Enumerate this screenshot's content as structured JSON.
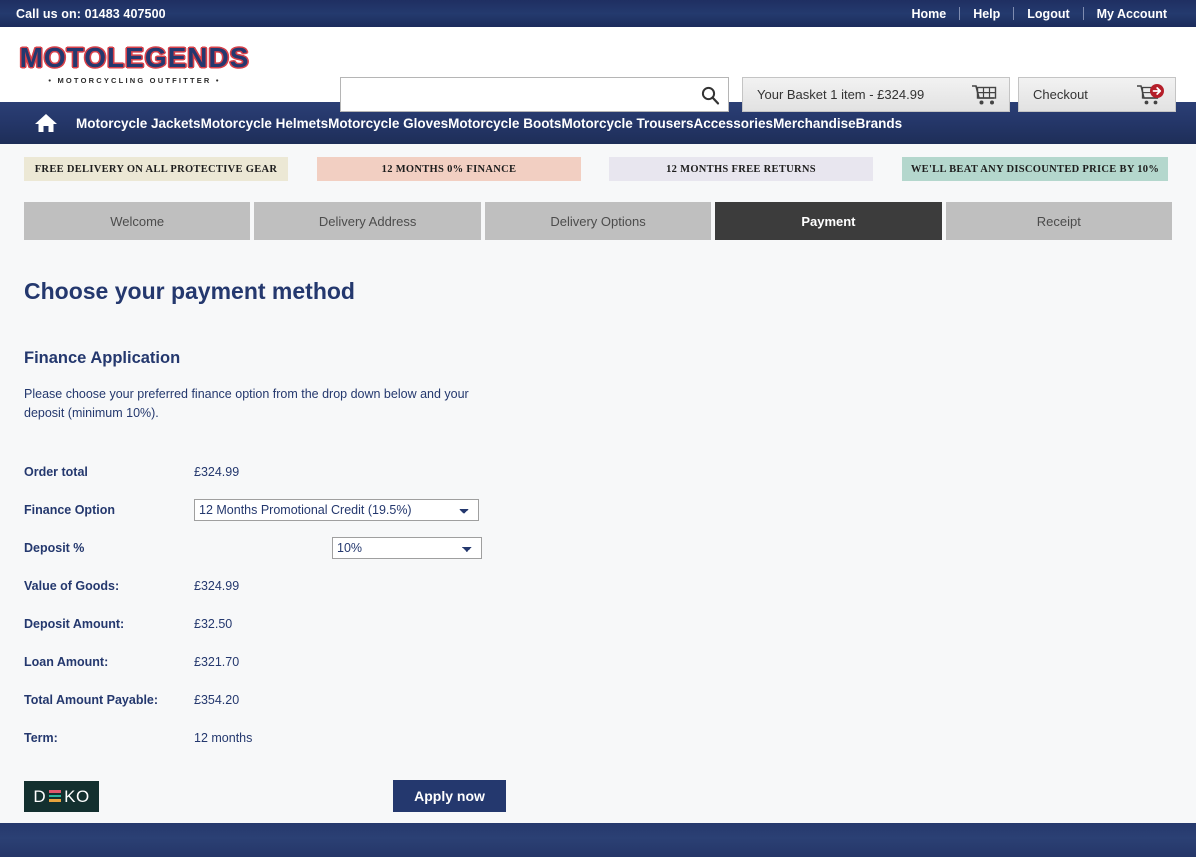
{
  "topbar": {
    "phone": "Call us on: 01483 407500",
    "links": [
      {
        "label": "Home"
      },
      {
        "label": "Help"
      },
      {
        "label": "Logout"
      },
      {
        "label": "My Account"
      }
    ]
  },
  "header": {
    "logo_main": "MOTOLEGENDS",
    "logo_sub": "• MOTORCYCLING OUTFITTER •",
    "search": {
      "value": "",
      "placeholder": "",
      "icon": "search-icon"
    },
    "basket": {
      "label": "Your Basket 1 item - £324.99",
      "icon": "cart-icon"
    },
    "checkout": {
      "label": "Checkout",
      "icon": "cart-arrow-icon"
    }
  },
  "nav": {
    "home_icon": "home-icon",
    "items": [
      {
        "label": "Motorcycle Jackets"
      },
      {
        "label": "Motorcycle Helmets"
      },
      {
        "label": "Motorcycle Gloves"
      },
      {
        "label": "Motorcycle Boots"
      },
      {
        "label": "Motorcycle Trousers"
      },
      {
        "label": "Accessories"
      },
      {
        "label": "Merchandise"
      },
      {
        "label": "Brands"
      }
    ]
  },
  "promos": [
    {
      "label": "FREE DELIVERY ON ALL PROTECTIVE GEAR",
      "color": "#ece8d5"
    },
    {
      "label": "12 MONTHS 0% FINANCE",
      "color": "#f2cfc2"
    },
    {
      "label": "12 MONTHS FREE RETURNS",
      "color": "#e8e6ef"
    },
    {
      "label": "WE'LL BEAT ANY DISCOUNTED PRICE BY 10%",
      "color": "#b4d7cd"
    }
  ],
  "steps": [
    {
      "label": "Welcome",
      "active": false
    },
    {
      "label": "Delivery Address",
      "active": false
    },
    {
      "label": "Delivery Options",
      "active": false
    },
    {
      "label": "Payment",
      "active": true
    },
    {
      "label": "Receipt",
      "active": false
    }
  ],
  "main": {
    "page_title": "Choose your payment method",
    "section_title": "Finance Application",
    "intro": "Please choose your preferred finance option from the drop down below and your deposit (minimum 10%).",
    "fields": {
      "order_total_label": "Order total",
      "order_total_value": "£324.99",
      "finance_option_label": "Finance Option",
      "finance_option_value": "12 Months Promotional Credit (19.5%)",
      "finance_option_choices": [
        "12 Months Promotional Credit (19.5%)"
      ],
      "deposit_label": "Deposit %",
      "deposit_value": "10%",
      "deposit_choices": [
        "10%"
      ],
      "value_of_goods_label": "Value of Goods:",
      "value_of_goods_value": "£324.99",
      "deposit_amount_label": "Deposit Amount:",
      "deposit_amount_value": "£32.50",
      "loan_amount_label": "Loan Amount:",
      "loan_amount_value": "£321.70",
      "total_payable_label": "Total Amount Payable:",
      "total_payable_value": "£354.20",
      "term_label": "Term:",
      "term_value": "12 months"
    },
    "deko": {
      "d": "D",
      "ko": "KO",
      "bar_colors": [
        "#e0576c",
        "#2bb39a",
        "#e8a33d"
      ]
    },
    "apply_button": "Apply now"
  },
  "colors": {
    "brand_navy": "#24386e",
    "brand_red": "#d8414a",
    "active_step": "#3c3c3c"
  }
}
